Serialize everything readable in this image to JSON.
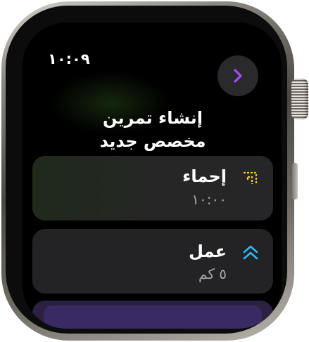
{
  "status_bar": {
    "time": "١٠:٠٩"
  },
  "header": {
    "title_line1": "إنشاء تمرين",
    "title_line2": "مخصص جديد"
  },
  "items": [
    {
      "label": "إحماء",
      "detail": "١٠:٠٠",
      "icon": "warmup-icon",
      "icon_color": "#f2c230"
    },
    {
      "label": "عمل",
      "detail": "٥ كم",
      "icon": "double-chevron-up-icon",
      "icon_color": "#2fb6f6"
    }
  ],
  "colors": {
    "accent": "#a64dff",
    "background": "#000000",
    "card": "#232325"
  }
}
